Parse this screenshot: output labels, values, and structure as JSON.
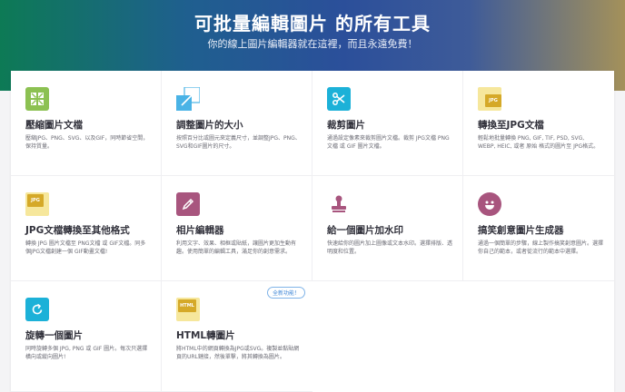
{
  "hero": {
    "title": "可批量編輯圖片 的所有工具",
    "subtitle": "你的線上圖片編輯器就在這裡，而且永遠免費！"
  },
  "tools": [
    {
      "title": "壓縮圖片文檔",
      "desc": "壓縮JPG、PNG、SVG、以及GIF，同時節省空間，保持質量。",
      "icon": "compress-icon",
      "color": "#8cc152"
    },
    {
      "title": "調整圖片的大小",
      "desc": "按照百分比或圖元來定義尺寸，並調整JPG、PNG、SVG和GIF圖片的尺寸。",
      "icon": "resize-icon",
      "color": "#4ab3e6"
    },
    {
      "title": "裁剪圖片",
      "desc": "通過設定像素來裁剪圖片文檔。裁剪 JPG文檔 PNG文檔 或 GIF 圖片文檔。",
      "icon": "scissors-icon",
      "color": "#1cb1d8"
    },
    {
      "title": "轉換至JPG文檔",
      "desc": "輕鬆地批量轉換 PNG, GIF, TIF, PSD, SVG, WEBP, HEIC, 或者 原始 格式的圖片至 JPG格式。",
      "icon": "jpg-file-icon",
      "file_label": "JPG",
      "color": "#d5a928"
    },
    {
      "title": "JPG文檔轉換至其他格式",
      "desc": "轉換 JPG 圖片文檔至 PNG文檔 或 GIF文檔。同多個JPG文檔創建一個 GIF動畫文檔!",
      "icon": "jpg-convert-icon",
      "file_label": "JPG",
      "color": "#d5a928"
    },
    {
      "title": "相片編輯器",
      "desc": "利用文字、效果、相框或貼紙，讓圖片更加生動有趣。使用簡單的編輯工具，滿足你的創意需求。",
      "icon": "pencil-icon",
      "color": "#a8557e"
    },
    {
      "title": "給一個圖片加水印",
      "desc": "快速給你的圖片加上圖像或文本水印。選擇排版、透明度和位置。",
      "icon": "stamp-icon",
      "color": "#a8557e"
    },
    {
      "title": "搞笑創意圖片生成器",
      "desc": "通過一個簡單的步驟，線上製作搞笑創意圖片。選擇你自己的範本，或者從流行的範本中選擇。",
      "icon": "smiley-icon",
      "color": "#a8557e"
    },
    {
      "title": "旋轉一個圖片",
      "desc": "同時旋轉多個 JPG, PNG 或 GIF 圖片。每次只選擇橫向或縱向圖片!",
      "icon": "rotate-icon",
      "color": "#1cb1d8"
    },
    {
      "title": "HTML轉圖片",
      "desc": "將HTML中的網頁轉換為JPG或SVG。複製並黏貼網頁的URL鏈接，然後單擊，將其轉換為圖片。",
      "icon": "html-file-icon",
      "file_label": "HTML",
      "color": "#d5a928",
      "badge": "全新功能！"
    }
  ]
}
